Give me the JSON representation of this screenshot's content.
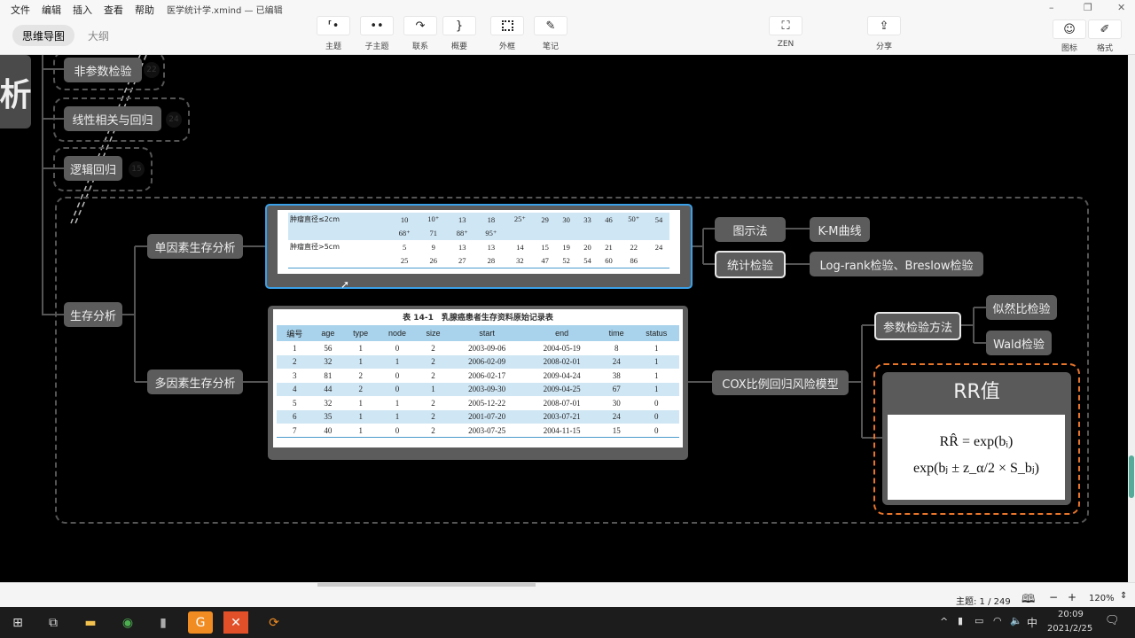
{
  "menu": [
    "文件",
    "编辑",
    "插入",
    "查看",
    "帮助"
  ],
  "doc_title": "医学统计学.xmind — 已编辑",
  "view_tabs": {
    "mindmap": "思维导图",
    "outline": "大纲"
  },
  "toolbar": [
    {
      "label": "主题",
      "icon": "topic-icon"
    },
    {
      "label": "子主题",
      "icon": "subtopic-icon"
    },
    {
      "label": "联系",
      "icon": "relationship-icon"
    },
    {
      "label": "概要",
      "icon": "summary-icon"
    },
    {
      "label": "外框",
      "icon": "boundary-icon"
    },
    {
      "label": "笔记",
      "icon": "note-icon"
    }
  ],
  "zen": "ZEN",
  "share": "分享",
  "icon_panel": "图标",
  "format_panel": "格式",
  "map": {
    "root_partial": "析",
    "siblings": [
      {
        "label": "非参数检验",
        "count": "22"
      },
      {
        "label": "线性相关与回归",
        "count": "24"
      },
      {
        "label": "逻辑回归",
        "count": "15"
      }
    ],
    "survival": "生存分析",
    "univariate": "单因素生存分析",
    "multivariate": "多因素生存分析",
    "graph_method": "图示法",
    "km": "K-M曲线",
    "stat_test": "统计检验",
    "logrank": "Log-rank检验、Breslow检验",
    "cox": "COX比例回归风险模型",
    "param_test": "参数检验方法",
    "lr_test": "似然比检验",
    "wald": "Wald检验",
    "rr_title": "RR值",
    "rr_formula1": "RR̂ = exp(bᵢ)",
    "rr_formula2": "exp(bⱼ ± z_α/2 × S_bⱼ)",
    "table1": {
      "rows": [
        [
          "肿瘤直径≤2cm",
          "10",
          "10⁺",
          "13",
          "18",
          "25⁺",
          "29",
          "30",
          "33",
          "46",
          "50⁺",
          "54"
        ],
        [
          "",
          "68⁺",
          "71",
          "88⁺",
          "95⁺",
          "",
          "",
          "",
          "",
          "",
          "",
          ""
        ],
        [
          "肿瘤直径>5cm",
          "5",
          "9",
          "13",
          "13",
          "14",
          "15",
          "19",
          "20",
          "21",
          "22",
          "24"
        ],
        [
          "",
          "25",
          "26",
          "27",
          "28",
          "32",
          "47",
          "52",
          "54",
          "60",
          "86",
          ""
        ]
      ]
    },
    "table2": {
      "caption": "表 14-1　乳腺癌患者生存资料原始记录表",
      "headers": [
        "编号",
        "age",
        "type",
        "node",
        "size",
        "start",
        "end",
        "time",
        "status"
      ],
      "rows": [
        [
          "1",
          "56",
          "1",
          "0",
          "2",
          "2003-09-06",
          "2004-05-19",
          "8",
          "1"
        ],
        [
          "2",
          "32",
          "1",
          "1",
          "2",
          "2006-02-09",
          "2008-02-01",
          "24",
          "1"
        ],
        [
          "3",
          "81",
          "2",
          "0",
          "2",
          "2006-02-17",
          "2009-04-24",
          "38",
          "1"
        ],
        [
          "4",
          "44",
          "2",
          "0",
          "1",
          "2003-09-30",
          "2009-04-25",
          "67",
          "1"
        ],
        [
          "5",
          "32",
          "1",
          "1",
          "2",
          "2005-12-22",
          "2008-07-01",
          "30",
          "0"
        ],
        [
          "6",
          "35",
          "1",
          "1",
          "2",
          "2001-07-20",
          "2003-07-21",
          "24",
          "0"
        ],
        [
          "7",
          "40",
          "1",
          "0",
          "2",
          "2003-07-25",
          "2004-11-15",
          "15",
          "0"
        ]
      ]
    }
  },
  "status": {
    "topic_count": "主题: 1 / 249",
    "zoom": "120%"
  },
  "taskbar": {
    "time": "20:09",
    "date": "2021/2/25",
    "ime": "中"
  }
}
